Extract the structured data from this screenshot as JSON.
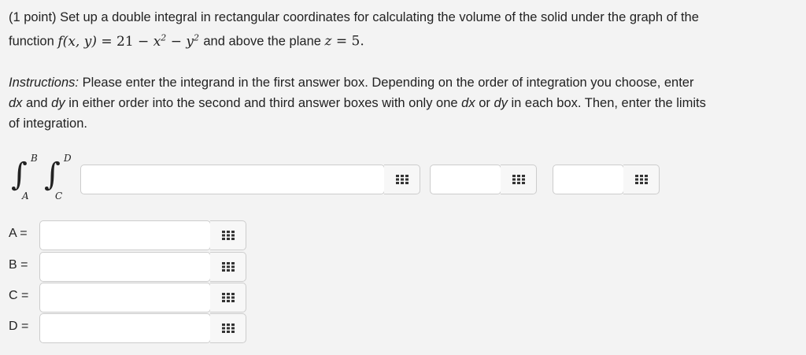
{
  "problem": {
    "points": "(1 point)",
    "line1": "Set up a double integral in rectangular coordinates for calculating the volume of the solid under the graph of the",
    "word_function": "function",
    "f_lhs": "f(x, y)",
    "eq_rhs_const": "= 21",
    "term_x2": "x",
    "term_y2": "y",
    "exp": "2",
    "and_above": "and above the plane",
    "plane": "z",
    "plane_value": "= 5."
  },
  "instructions": {
    "prefix": "Instructions:",
    "text1": "Please enter the integrand in the first answer box. Depending on the order of integration you choose, enter",
    "dx": "dx",
    "and": "and",
    "dy": "dy",
    "text2": "in either order into the second and third answer boxes with only one",
    "or": "or",
    "text3": "in each box. Then, enter the limits",
    "text4": "of integration."
  },
  "integral": {
    "outer_upper": "B",
    "outer_lower": "A",
    "inner_upper": "D",
    "inner_lower": "C",
    "symbol": "∫"
  },
  "limits": [
    {
      "label": "A =",
      "value": ""
    },
    {
      "label": "B =",
      "value": ""
    },
    {
      "label": "C =",
      "value": ""
    },
    {
      "label": "D =",
      "value": ""
    }
  ],
  "answers": {
    "integrand": "",
    "differential1": "",
    "differential2": ""
  },
  "palette_icon": "equation-palette-icon"
}
